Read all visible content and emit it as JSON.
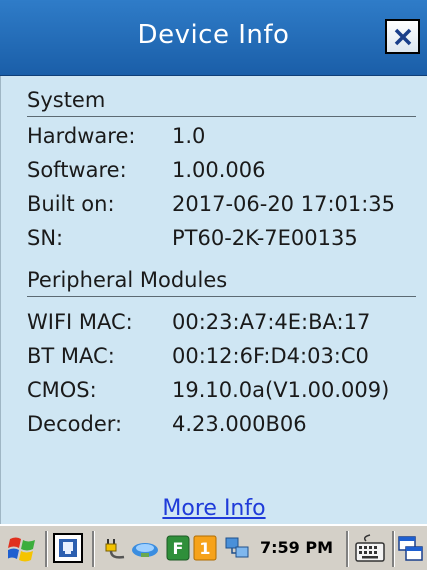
{
  "window": {
    "title": "Device Info"
  },
  "system": {
    "heading": "System",
    "rows": [
      {
        "label": "Hardware:",
        "value": "1.0"
      },
      {
        "label": "Software:",
        "value": "1.00.006"
      },
      {
        "label": "Built on:",
        "value": "2017-06-20 17:01:35"
      },
      {
        "label": "SN:",
        "value": "PT60-2K-7E00135"
      }
    ]
  },
  "peripheral": {
    "heading": "Peripheral Modules",
    "rows": [
      {
        "label": "WIFI MAC:",
        "value": "00:23:A7:4E:BA:17"
      },
      {
        "label": "BT MAC:",
        "value": "00:12:6F:D4:03:C0"
      },
      {
        "label": "CMOS:",
        "value": "19.10.0a(V1.00.009)"
      },
      {
        "label": "Decoder:",
        "value": "4.23.000B06"
      }
    ]
  },
  "footer": {
    "more_info_link": "More Info"
  },
  "taskbar": {
    "clock": "7:59 PM",
    "tray_badge_f": "F",
    "tray_badge_1": "1",
    "icons": [
      "windows-start-icon",
      "desktop-icon",
      "power-plug-icon",
      "network-icon",
      "f-key-icon",
      "number-one-icon",
      "connection-icon",
      "keyboard-icon",
      "window-switch-icon"
    ]
  },
  "colors": {
    "titlebar": "#1a5ea8",
    "background": "#cfe6f3",
    "link": "#1f3bd9",
    "taskbar": "#d4d0c8"
  }
}
